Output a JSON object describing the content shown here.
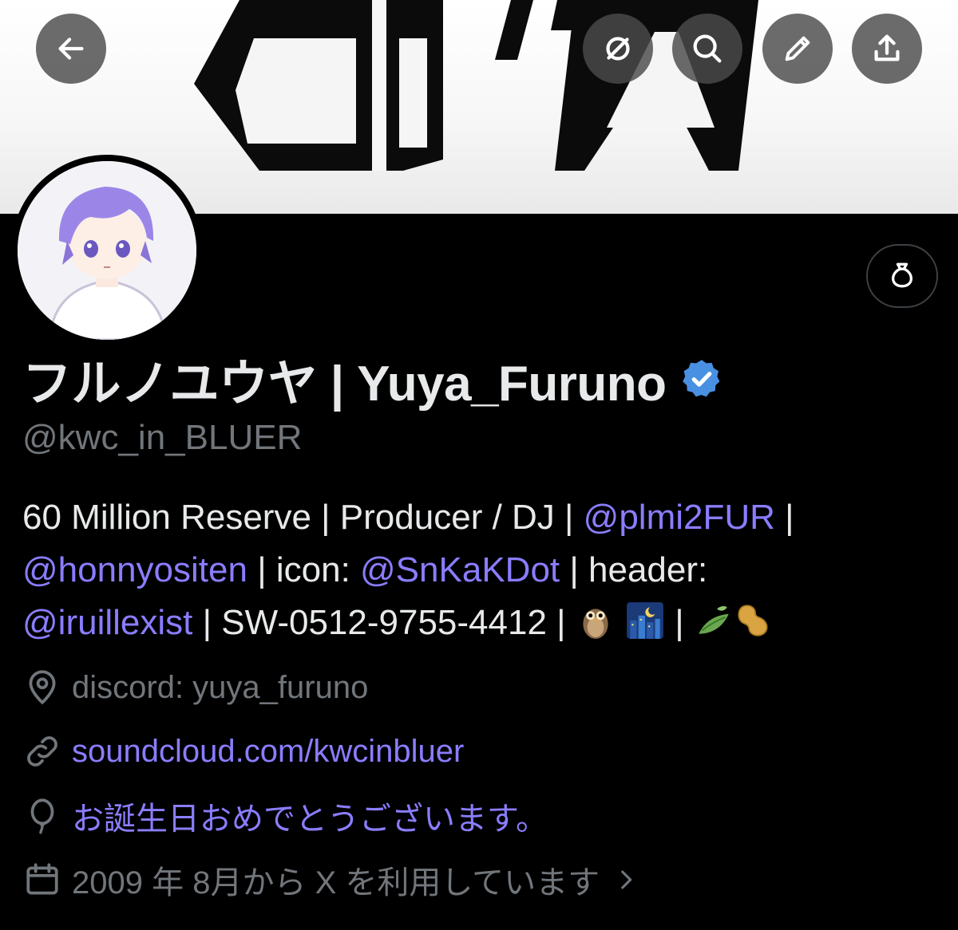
{
  "nav": {
    "back_icon": "arrow-left-icon",
    "actions": [
      "grok-icon",
      "search-icon",
      "edit-pencil-icon",
      "share-upload-icon"
    ]
  },
  "profile": {
    "display_name": "フルノユウヤ | Yuya_Furuno",
    "verified_icon": "verified-badge-icon",
    "verified_color": "#4a90e2",
    "handle": "@kwc_in_BLUER",
    "tip_icon": "money-bag-icon"
  },
  "bio": {
    "line1_text1": "60 Million Reserve | Producer / DJ | ",
    "line1_mention1": "@plmi2FUR",
    "line1_text2": " |",
    "line2_mention1": "@honnyositen",
    "line2_text1": " | icon: ",
    "line2_mention2": "@SnKaKDot",
    "line2_text2": " | header:",
    "line3_mention1": "@iruillexist",
    "line3_text1": " | SW-0512-9755-4412 | ",
    "line3_text2": " | ",
    "emojis": [
      "owl-emoji",
      "night-city-emoji",
      "leaves-emoji",
      "peanut-emoji"
    ]
  },
  "meta": {
    "location_icon": "location-pin-icon",
    "location": "discord: yuya_furuno",
    "link_icon": "link-icon",
    "link": "soundcloud.com/kwcinbluer",
    "birthday_icon": "balloon-icon",
    "birthday": "お誕生日おめでとうございます。",
    "joined_icon": "calendar-icon",
    "joined": "2009 年 8月から X を利用しています",
    "chevron_icon": "chevron-right-icon"
  },
  "colors": {
    "background": "#000000",
    "text_primary": "#e7e9ea",
    "text_secondary": "#71767b",
    "link": "#8a7dff",
    "verified": "#4a90e2"
  }
}
